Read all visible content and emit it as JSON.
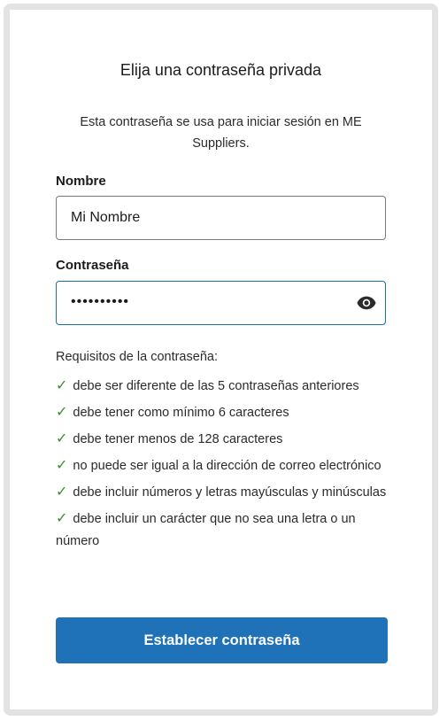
{
  "dialog": {
    "title": "Elija una contraseña privada",
    "subtitle": "Esta contraseña se usa para iniciar sesión en ME Suppliers."
  },
  "form": {
    "name_label": "Nombre",
    "name_value": "Mi Nombre",
    "password_label": "Contraseña",
    "password_masked": "••••••••••",
    "show_password_icon": "eye-icon"
  },
  "requirements": {
    "title": "Requisitos de la contraseña:",
    "check_symbol": "✓",
    "items": [
      "debe ser diferente de las 5 contraseñas anteriores",
      "debe tener como mínimo 6 caracteres",
      "debe tener menos de 128 caracteres",
      "no puede ser igual a la dirección de correo electrónico",
      "debe incluir números y letras mayúsculas y minúsculas",
      "debe incluir un carácter que no sea una letra o un número"
    ]
  },
  "actions": {
    "submit_label": "Establecer contraseña"
  },
  "colors": {
    "primary": "#1f72b8",
    "check": "#3a8d2c",
    "focus_border": "#1a6fb0"
  }
}
